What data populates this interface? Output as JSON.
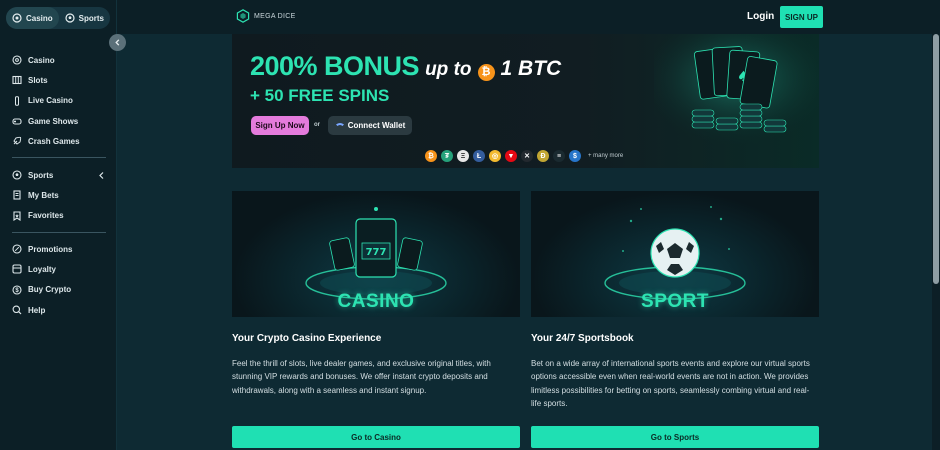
{
  "sidebar": {
    "switch": {
      "casino": "Casino",
      "sports": "Sports"
    },
    "groups": [
      {
        "items": [
          {
            "label": "Casino",
            "icon": "casino-chip-icon"
          },
          {
            "label": "Slots",
            "icon": "slots-icon"
          },
          {
            "label": "Live Casino",
            "icon": "live-casino-icon"
          },
          {
            "label": "Game Shows",
            "icon": "game-shows-icon"
          },
          {
            "label": "Crash Games",
            "icon": "rocket-icon"
          }
        ]
      },
      {
        "items": [
          {
            "label": "Sports",
            "icon": "football-icon"
          },
          {
            "label": "My Bets",
            "icon": "my-bets-icon"
          },
          {
            "label": "Favorites",
            "icon": "favorites-icon"
          }
        ]
      },
      {
        "items": [
          {
            "label": "Promotions",
            "icon": "promotions-icon"
          },
          {
            "label": "Loyalty",
            "icon": "loyalty-icon"
          },
          {
            "label": "Buy Crypto",
            "icon": "crypto-icon"
          },
          {
            "label": "Help",
            "icon": "help-icon"
          }
        ]
      }
    ]
  },
  "header": {
    "logo_text": "MEGA DICE",
    "login": "Login",
    "signup": "SIGN UP"
  },
  "banner": {
    "bonus": "200% BONUS",
    "up_to": "up to",
    "btc_symbol": "₿",
    "btc_amount": "1 BTC",
    "free_spins": "+ 50 FREE SPINS",
    "signup_now": "Sign Up Now",
    "or": "or",
    "connect_wallet": "Connect Wallet",
    "many_more": "+ many more",
    "coins": [
      {
        "symbol": "₿",
        "color": "#f7931a"
      },
      {
        "symbol": "₮",
        "color": "#26a17b"
      },
      {
        "symbol": "Ξ",
        "color": "#e8e8e8"
      },
      {
        "symbol": "Ł",
        "color": "#345d9d"
      },
      {
        "symbol": "◎",
        "color": "#f3ba2f"
      },
      {
        "symbol": "▼",
        "color": "#e50914"
      },
      {
        "symbol": "✕",
        "color": "#23292f"
      },
      {
        "symbol": "Ð",
        "color": "#c2a633"
      },
      {
        "symbol": "≡",
        "color": "#1a2a30"
      },
      {
        "symbol": "$",
        "color": "#2775ca"
      }
    ]
  },
  "casino": {
    "label": "CASINO",
    "title": "Your Crypto Casino Experience",
    "desc": "Feel the thrill of slots, live dealer games, and exclusive original titles, with stunning VIP rewards and bonuses. We offer instant crypto deposits and withdrawals, along with a seamless and instant signup.",
    "button": "Go to Casino"
  },
  "sport": {
    "label": "SPORT",
    "title": "Your 24/7 Sportsbook",
    "desc": "Bet on a wide array of international sports events and explore our virtual sports options accessible even when real-world events are not in action. We provides limitless possibilities for betting on sports, seamlessly combing virtual and real-life sports.",
    "button": "Go to Sports"
  },
  "colors": {
    "accent": "#1fe0b3",
    "pink": "#e47bdc",
    "bg": "#0e2a33",
    "sidebar": "#0c1f26"
  }
}
